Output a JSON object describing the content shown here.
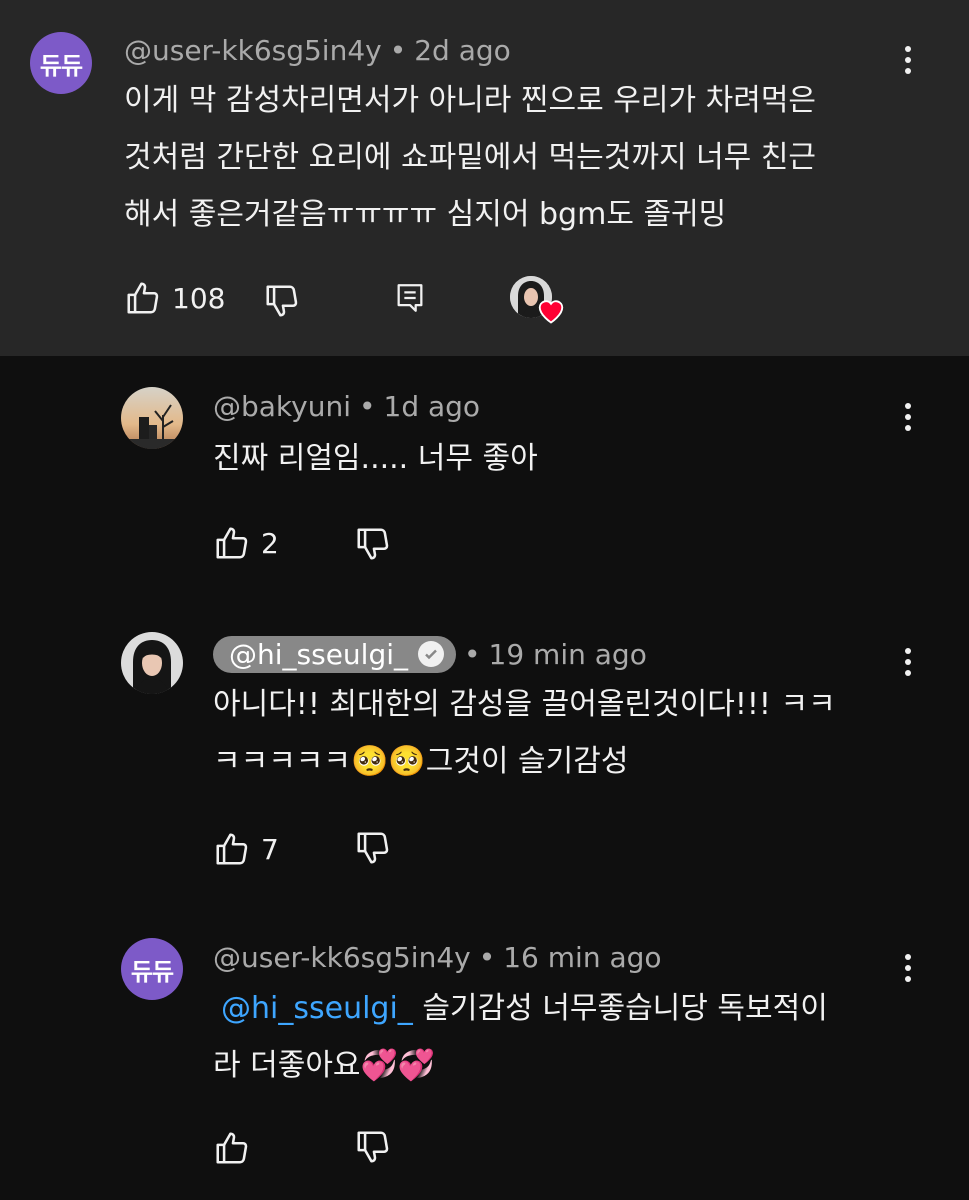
{
  "colors": {
    "top_comment_bg": "#272727",
    "page_bg": "#0f0f0f",
    "avatar_purple": "#7d5ac8",
    "mention_blue": "#3ea6ff",
    "heart_red": "#ff0033"
  },
  "top_comment": {
    "avatar_text": "듀듀",
    "author": "@user-kk6sg5in4y",
    "time": "2d ago",
    "lines": [
      "이게 막 감성차리면서가 아니라 찐으로 우리가 차려먹은",
      "것처럼 간단한 요리에 쇼파밑에서 먹는것까지 너무 친근",
      "해서 좋은거같음ㅠㅠㅠㅠ 심지어 bgm도 졸귀밍"
    ],
    "likes": "108",
    "icons": [
      "like-icon",
      "dislike-icon",
      "reply-icon",
      "creator-heart-icon",
      "more-vert-icon"
    ]
  },
  "replies": [
    {
      "author": "@bakyuni",
      "time": "1d ago",
      "lines": [
        "진짜 리얼임..... 너무 좋아"
      ],
      "likes": "2"
    },
    {
      "author": "@hi_sseulgi_",
      "time": "19 min ago",
      "verified": true,
      "lines": [
        "아니다!! 최대한의 감성을 끌어올린것이다!!! ㅋㅋ",
        "ㅋㅋㅋㅋㅋ🥺🥺그것이 슬기감성"
      ],
      "likes": "7"
    },
    {
      "avatar_text": "듀듀",
      "author": "@user-kk6sg5in4y",
      "time": "16 min ago",
      "mention": "@hi_sseulgi_",
      "line1_rest": " 슬기감성 너무좋습니당 독보적이",
      "line2": "라 더좋아요💞💞",
      "likes": ""
    }
  ]
}
